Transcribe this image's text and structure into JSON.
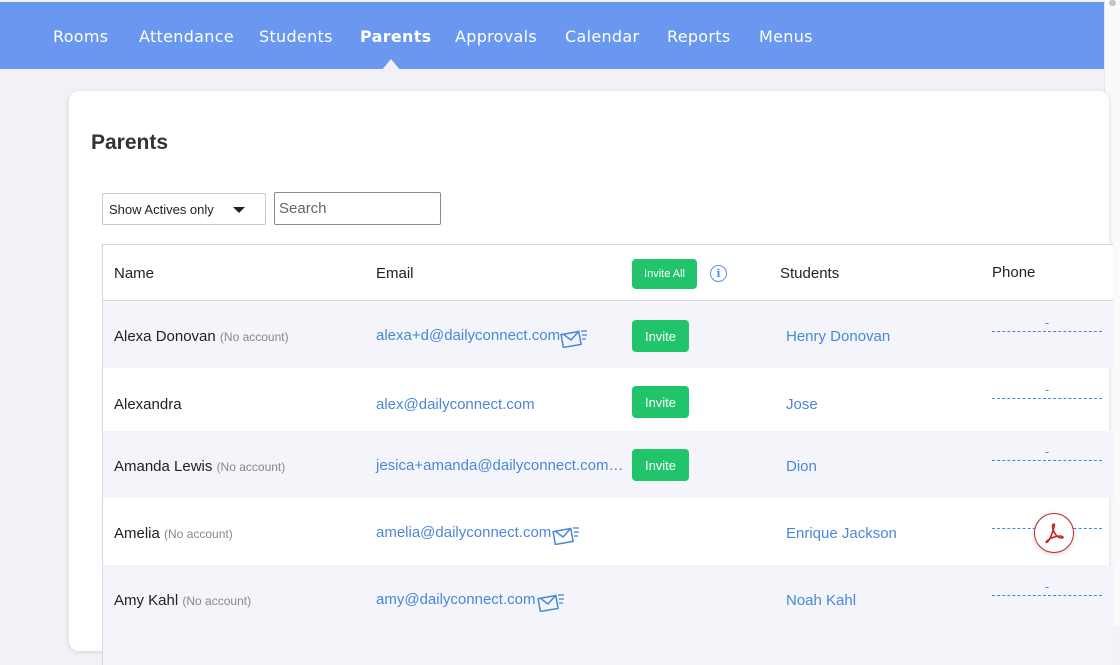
{
  "nav": {
    "items": [
      {
        "label": "Rooms",
        "active": false
      },
      {
        "label": "Attendance",
        "active": false
      },
      {
        "label": "Students",
        "active": false
      },
      {
        "label": "Parents",
        "active": true
      },
      {
        "label": "Approvals",
        "active": false
      },
      {
        "label": "Calendar",
        "active": false
      },
      {
        "label": "Reports",
        "active": false
      },
      {
        "label": "Menus",
        "active": false
      }
    ]
  },
  "page": {
    "title": "Parents"
  },
  "filters": {
    "status_select": "Show Actives only",
    "search_placeholder": "Search"
  },
  "table": {
    "headers": {
      "name": "Name",
      "email": "Email",
      "invite_all": "Invite All",
      "students": "Students",
      "phone": "Phone"
    },
    "rows": [
      {
        "name": "Alexa Donovan",
        "account": "(No account)",
        "email": "alexa+d@dailyconnect.com",
        "invite": "Invite",
        "student": "Henry Donovan",
        "phone": "-"
      },
      {
        "name": "Alexandra",
        "account": "",
        "email": "alex@dailyconnect.com",
        "invite": "Invite",
        "student": "Jose",
        "phone": "-"
      },
      {
        "name": "Amanda Lewis",
        "account": "(No account)",
        "email": "jesica+amanda@dailyconnect.com…",
        "invite": "Invite",
        "student": "Dion",
        "phone": "-"
      },
      {
        "name": "Amelia",
        "account": "(No account)",
        "email": "amelia@dailyconnect.com",
        "invite": "",
        "student": "Enrique Jackson",
        "phone": ""
      },
      {
        "name": "Amy Kahl",
        "account": "(No account)",
        "email": "amy@dailyconnect.com",
        "invite": "",
        "student": "Noah Kahl",
        "phone": "-"
      }
    ]
  },
  "colors": {
    "nav_bg": "#6a97f0",
    "invite_green": "#22c46b",
    "link_blue": "#4a87d9"
  }
}
